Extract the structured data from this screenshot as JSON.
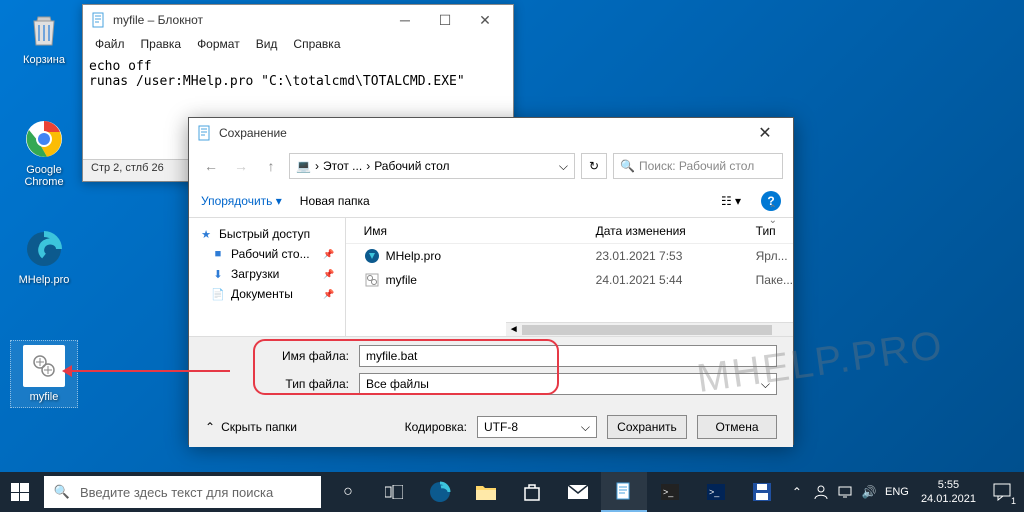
{
  "desktop": {
    "icons": [
      {
        "label": "Корзина"
      },
      {
        "label": "Google Chrome"
      },
      {
        "label": "MHelp.pro"
      },
      {
        "label": "myfile"
      }
    ]
  },
  "notepad": {
    "title": "myfile – Блокнот",
    "menu": {
      "file": "Файл",
      "edit": "Правка",
      "format": "Формат",
      "view": "Вид",
      "help": "Справка"
    },
    "content": "echo off\nrunas /user:MHelp.pro \"C:\\totalcmd\\TOTALCMD.EXE\"",
    "status": "Стр 2, стлб 26"
  },
  "save_dialog": {
    "title": "Сохранение",
    "breadcrumb": {
      "root_icon": "💻",
      "part1": "Этот ...",
      "part2": "Рабочий стол"
    },
    "search_placeholder": "Поиск: Рабочий стол",
    "toolbar": {
      "organize": "Упорядочить",
      "new_folder": "Новая папка"
    },
    "sidebar": {
      "quick": "Быстрый доступ",
      "desktop": "Рабочий сто...",
      "downloads": "Загрузки",
      "documents": "Документы"
    },
    "columns": {
      "name": "Имя",
      "date": "Дата изменения",
      "type": "Тип"
    },
    "files": [
      {
        "name": "MHelp.pro",
        "date": "23.01.2021 7:53",
        "type": "Ярл..."
      },
      {
        "name": "myfile",
        "date": "24.01.2021 5:44",
        "type": "Паке..."
      }
    ],
    "filename_label": "Имя файла:",
    "filename_value": "myfile.bat",
    "filetype_label": "Тип файла:",
    "filetype_value": "Все файлы",
    "hide_folders": "Скрыть папки",
    "encoding_label": "Кодировка:",
    "encoding_value": "UTF-8",
    "save_btn": "Сохранить",
    "cancel_btn": "Отмена"
  },
  "taskbar": {
    "search_placeholder": "Введите здесь текст для поиска",
    "lang": "ENG",
    "time": "5:55",
    "date": "24.01.2021",
    "notif_count": "1"
  },
  "watermark": "MHELP.PRO"
}
